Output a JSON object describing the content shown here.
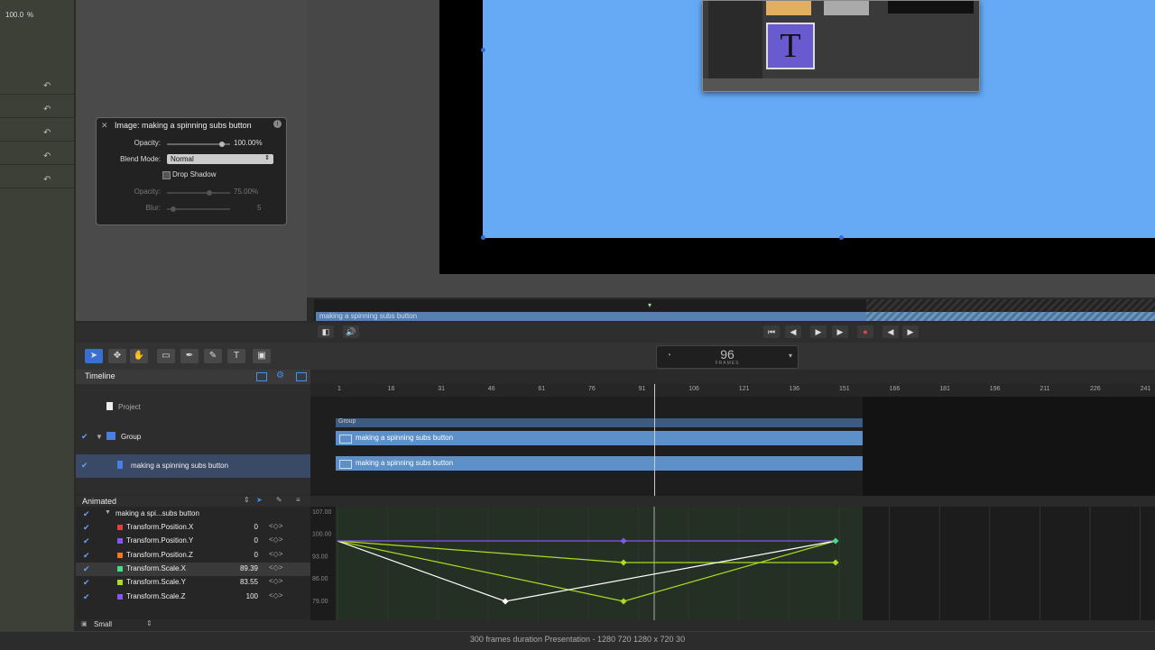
{
  "inspector": {
    "opacity_readout": "100.0",
    "opacity_unit": "%"
  },
  "hud": {
    "title": "Image: making a spinning subs button",
    "opacity_label": "Opacity:",
    "opacity_value": "100.00%",
    "blend_label": "Blend Mode:",
    "blend_value": "Normal",
    "drop_shadow_label": "Drop Shadow",
    "shadow_opacity_label": "Opacity:",
    "shadow_opacity_value": "75.00%",
    "blur_label": "Blur:",
    "blur_value": "5"
  },
  "mini_timeline": {
    "clip_label": "making a spinning subs button"
  },
  "frame_counter": {
    "value": "96",
    "unit": "FRAMES"
  },
  "timeline": {
    "header": "Timeline",
    "ruler_ticks": [
      "1",
      "16",
      "31",
      "46",
      "61",
      "76",
      "91",
      "106",
      "121",
      "136",
      "151",
      "166",
      "181",
      "196",
      "211",
      "226",
      "241"
    ],
    "layers": {
      "project": "Project",
      "group": "Group",
      "image": "making a spinning subs button"
    },
    "group_label": "Group",
    "track1_label": "making a spinning subs button",
    "track2_label": "making a spinning subs button"
  },
  "animated": {
    "header": "Animated",
    "parent": "making a spi...subs button",
    "rows": [
      {
        "name": "Transform.Position.X",
        "value": "0",
        "color": "#e04040"
      },
      {
        "name": "Transform.Position.Y",
        "value": "0",
        "color": "#8855ee"
      },
      {
        "name": "Transform.Position.Z",
        "value": "0",
        "color": "#ee7722"
      },
      {
        "name": "Transform.Scale.X",
        "value": "89.39",
        "color": "#44dd88"
      },
      {
        "name": "Transform.Scale.Y",
        "value": "83.55",
        "color": "#aadd22"
      },
      {
        "name": "Transform.Scale.Z",
        "value": "100",
        "color": "#8855ee"
      }
    ],
    "graph_labels": [
      "107.00",
      "100.00",
      "93.00",
      "86.00",
      "79.00"
    ],
    "zoom": "Small"
  },
  "status": {
    "text": "300 frames duration Presentation - 1280 720 1280 x 720 30"
  }
}
